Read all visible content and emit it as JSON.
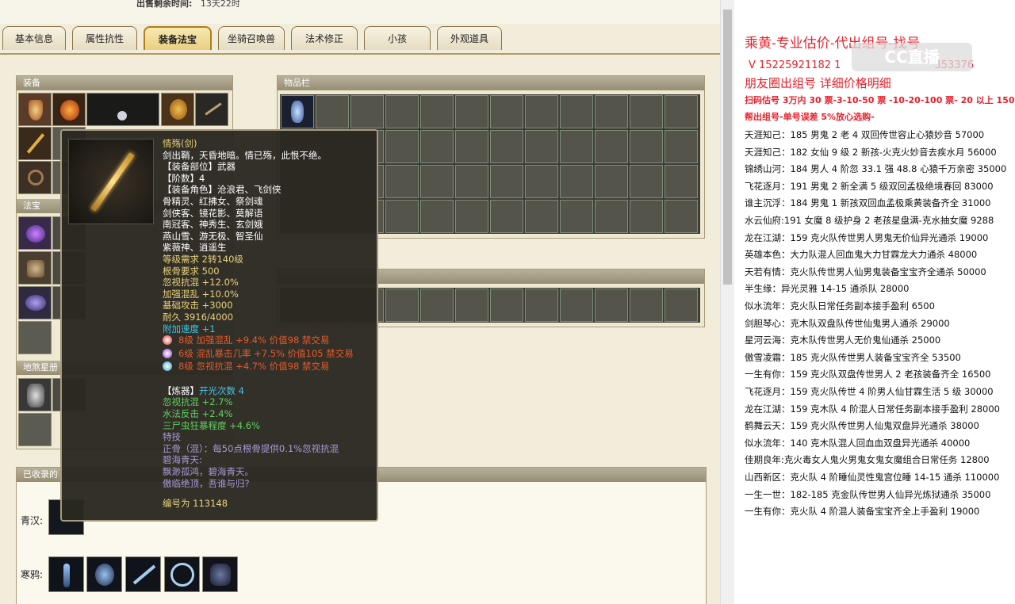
{
  "sale": {
    "label": "出售剩余时间:",
    "value": "13天22时"
  },
  "tabs": [
    "基本信息",
    "属性抗性",
    "装备法宝",
    "坐骑召唤兽",
    "法术修正",
    "小孩",
    "外观道具"
  ],
  "panels": {
    "equip": "装备",
    "fabao": "法宝",
    "dishalan": "地煞星册",
    "items": "物品栏",
    "collected": "已收录的"
  },
  "collected_rows": [
    "青汉:",
    "寒鸦:"
  ],
  "tooltip": {
    "name": "情殇(剑)",
    "desc": "剑出鞘，天昏地暗。情已殇，此恨不绝。",
    "slot": "【装备部位】武器",
    "tier": "【阶数】4",
    "roles_head": "【装备角色】沧浪君、飞剑侠",
    "roles": [
      "骨精灵、红拂女、祭剑魂",
      "剑侠客、镜花影、莫解语",
      "南冠客、神秀生、玄剑娥",
      "燕山雪、游无极、智圣仙",
      "紫薇神、逍遥生"
    ],
    "level_req": "等级需求 2转140级",
    "bone_req": "根骨要求 500",
    "stats_yellow": [
      "忽视抗混 +12.0%",
      "加强混乱 +10.0%",
      "基础攻击 +3000",
      "耐久 3916/4000"
    ],
    "speed": "附加速度 +1",
    "gems": [
      {
        "text": "8级 加强混乱 +9.4% 价值98 禁交易",
        "color": "#e0302a"
      },
      {
        "text": "6级 混乱暴击几率 +7.5% 价值105 禁交易",
        "color": "#9b3ae0"
      },
      {
        "text": "8级 忽视抗混 +4.7% 价值98 禁交易",
        "color": "#2aa0c8"
      }
    ],
    "refine_label": "【炼器】",
    "refine_value": "开光次数 4",
    "refine_stats": [
      "忽视抗混 +2.7%",
      "水法反击 +2.4%",
      "三尸虫狂暴程度 +4.6%"
    ],
    "special": "特技",
    "special_lines": [
      "正骨（混）：每50点根骨提供0.1%忽视抗混",
      "碧海青天:",
      "飘渺孤鸿，碧海青天。",
      "傲临绝顶，吾谁与归?"
    ],
    "serial": "编号为 113148"
  },
  "right": {
    "title": "乘黄-专业估价-代出组号-找号",
    "phone": "V 15225921182   1",
    "phone_tail": "353376",
    "watermark": "CC直播",
    "friends": "朋友圈出组号    详细价格明细",
    "rule1": "扫码估号 3万内 30 票-3-10-50 票  -10-20-100 票- 20 以上 150",
    "rule2": "帮出组号-单号误差 5%放心选购-",
    "entries": [
      "天涯知己：185 男鬼 2 老 4 双回传世容止心猿妙音 57000",
      "天涯知己：182 女仙 9 级 2 新孩-火克火妙音去疾水月 56000",
      "锦绣山河：184 男人 4 阶忽 33.1 强 48.8 心猿千万亲密 35000",
      "飞花逐月：191 男鬼 2 新全满 5 级双回孟极绝境春回 83000",
      "谁主沉浮：184 男鬼 1 新孩双回血孟极乘黄装备齐全 31000",
      "水云仙府:191 女魔 8 级护身 2 老孩星盘满-克水抽女魔 9288",
      "龙在江湖：159 克火队传世男人男鬼无价仙异光通杀 19000",
      "英雄本色：大力队混人回血鬼大力甘霖龙大力通杀 48000",
      "天若有情：克火队传世男人仙男鬼装备宝宝齐全通杀 50000",
      "半生缘：异光灵雅 14-15 通杀队 28000",
      "似水流年：克火队日常任务副本接手盈利 6500",
      "剑胆琴心：克木队双盘队传世仙鬼男人通杀 29000",
      "星河云海：克木队传世男人无价鬼仙通杀 25000",
      "傲雪凌霜：185 克火队传世男人装备宝宝齐全 53500",
      "一生有你：159 克火队双盘传世男人 2 老孩装备齐全 16500",
      "飞花逐月：159 克火队传世 4 阶男人仙甘霖生活 5 级 30000",
      "龙在江湖：159 克木队 4 阶混人日常任务副本接手盈利 28000",
      "鹤舞云天：159 克火队传世男人仙鬼双盘异光通杀 38000",
      "似水流年：140 克木队混人回血血双盘异光通杀 40000",
      "佳期良年:克火毒女人鬼火男鬼女鬼女魔组合日常任务 12800",
      "山西新区：克火队 4 阶睡仙灵性鬼宫位睡 14-15 通杀 110000",
      "一生一世：182-185 克金队传世男人仙异光炼狱通杀 35000",
      "一生有你：克火队 4 阶混人装备宝宝齐全上手盈利 19000"
    ]
  },
  "colors": {
    "red": "#e8202a",
    "blue": "#1f3cc8",
    "tipYellow": "#e8d27a",
    "tipGreen": "#5fd35f",
    "tipCyan": "#41c7e6",
    "tipPurple": "#a99bd8"
  }
}
